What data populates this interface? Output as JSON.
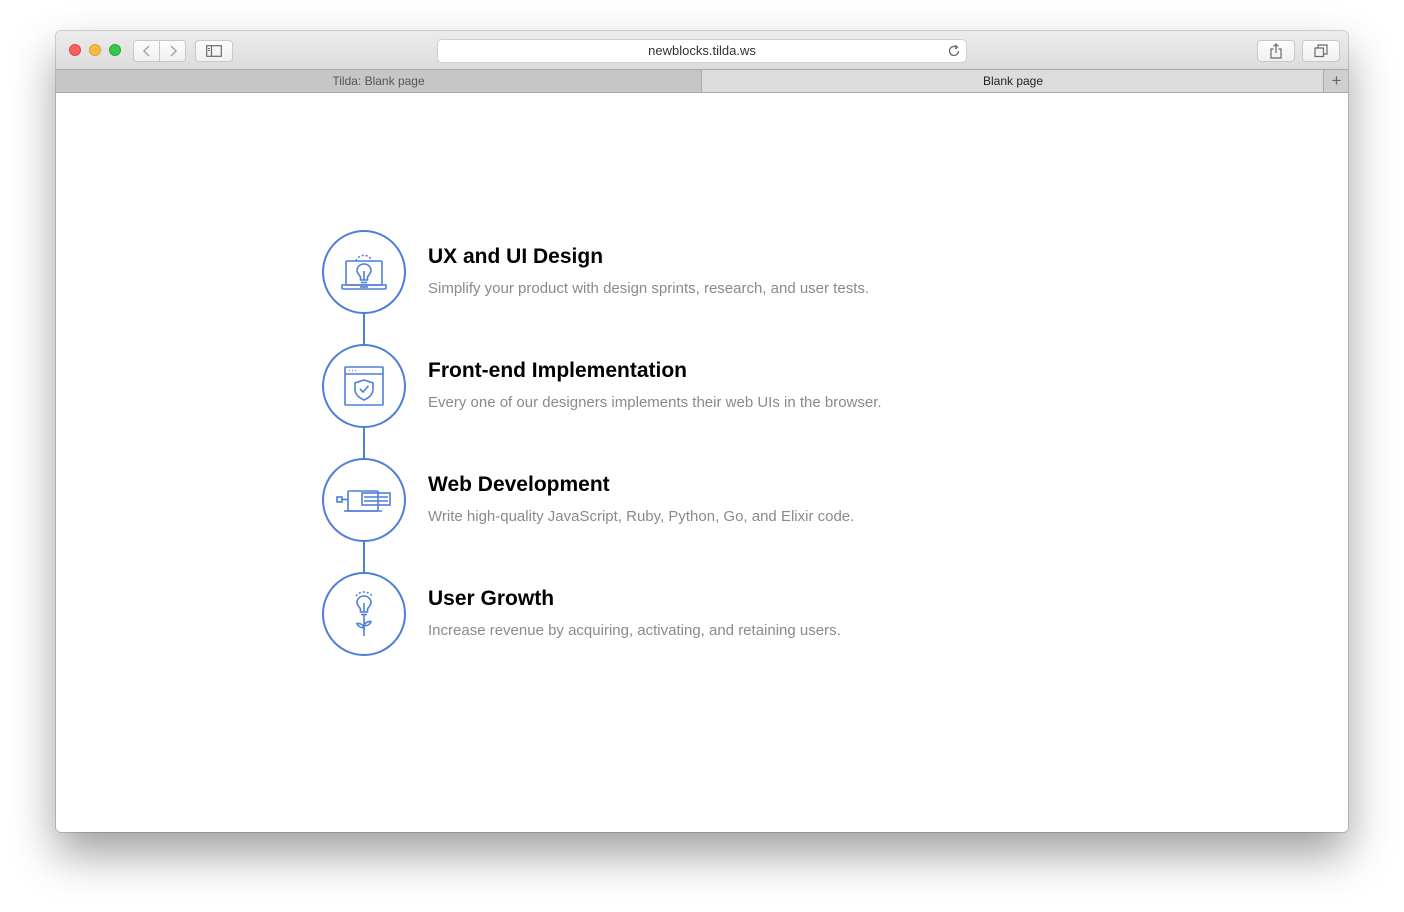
{
  "browser": {
    "url": "newblocks.tilda.ws",
    "tabs": [
      {
        "label": "Tilda: Blank page",
        "active": false
      },
      {
        "label": "Blank page",
        "active": true
      }
    ],
    "new_tab_label": "+",
    "icons": {
      "back": "chevron-left-icon",
      "forward": "chevron-right-icon",
      "sidebar": "sidebar-icon",
      "reload": "reload-icon",
      "share": "share-icon",
      "tabs_overview": "tabs-overview-icon"
    }
  },
  "services": [
    {
      "title": "UX and UI Design",
      "description": "Simplify your product with design sprints, research, and user tests.",
      "icon": "laptop-lightbulb-icon"
    },
    {
      "title": "Front-end Implementation",
      "description": "Every one of our designers implements their web UIs in the browser.",
      "icon": "browser-shield-icon"
    },
    {
      "title": "Web Development",
      "description": "Write high-quality JavaScript, Ruby, Python, Go, and Elixir code.",
      "icon": "code-plug-icon"
    },
    {
      "title": "User Growth",
      "description": "Increase revenue by acquiring, activating, and retaining users.",
      "icon": "lightbulb-plant-icon"
    }
  ],
  "colors": {
    "accent": "#4e7fd8",
    "title": "#000000",
    "description": "#8a8a8a"
  }
}
